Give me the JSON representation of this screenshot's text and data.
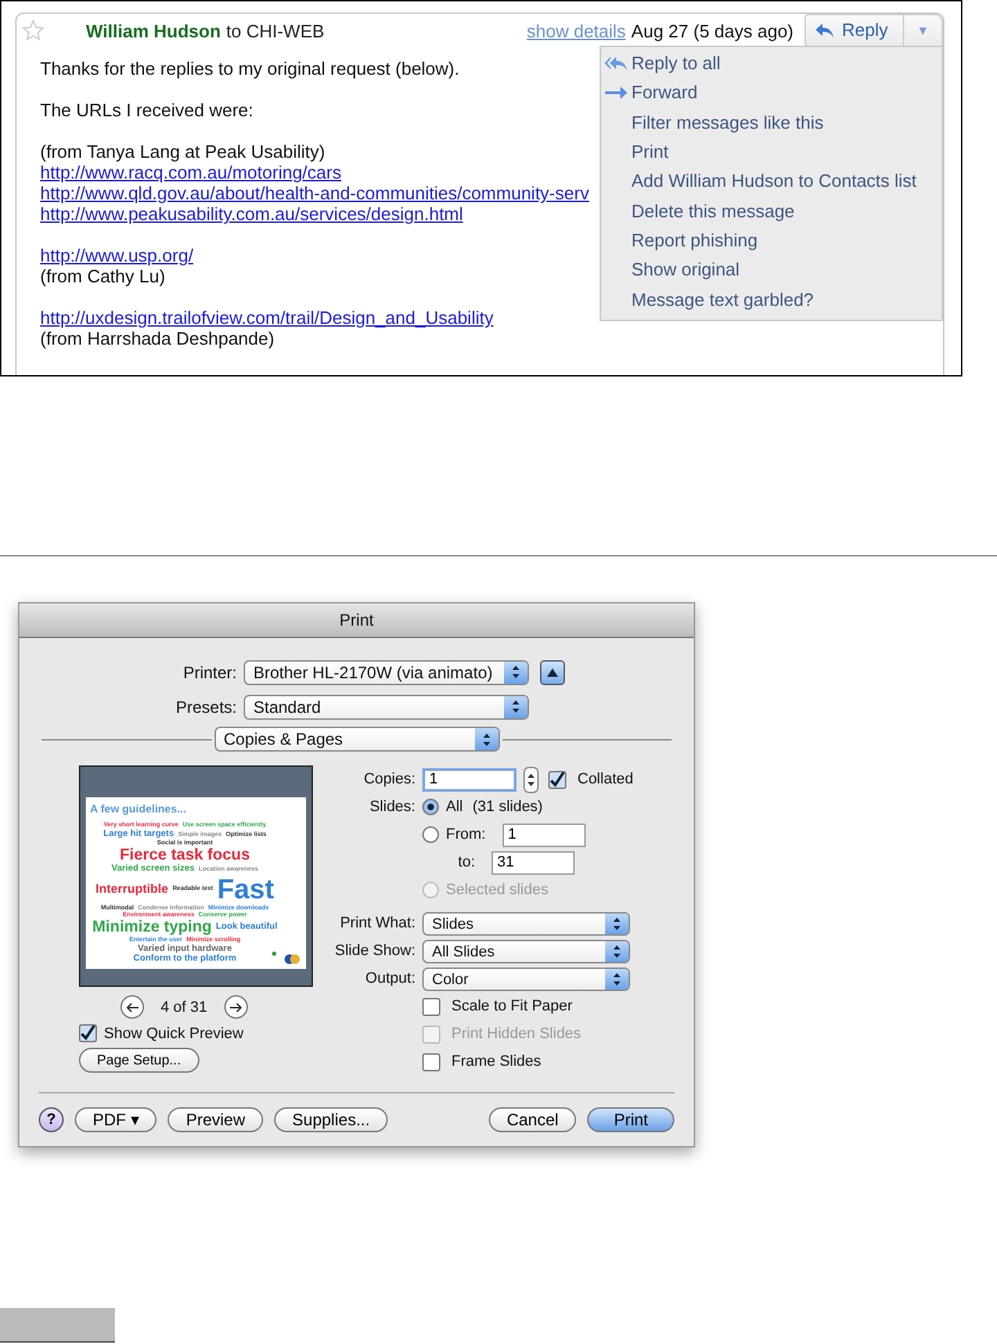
{
  "email": {
    "starred": false,
    "sender": "William Hudson",
    "recipient": "to CHI-WEB",
    "show_details": "show details",
    "date": "Aug 27 (5 days ago)",
    "reply_button": "Reply",
    "menu_button": "▼",
    "menu": [
      {
        "label": "Reply to all",
        "kind": "reply-all"
      },
      {
        "label": "Forward",
        "kind": "forward"
      },
      {
        "label": "Filter messages like this",
        "kind": "plain"
      },
      {
        "label": "Print",
        "kind": "plain"
      },
      {
        "label": "Add William Hudson to Contacts list",
        "kind": "plain"
      },
      {
        "label": "Delete this message",
        "kind": "plain"
      },
      {
        "label": "Report phishing",
        "kind": "plain"
      },
      {
        "label": "Show original",
        "kind": "plain"
      },
      {
        "label": "Message text garbled?",
        "kind": "plain"
      }
    ],
    "body": [
      [
        {
          "kind": "text",
          "text": "Thanks for the replies to my original request (below)."
        }
      ],
      [
        {
          "kind": "text",
          "text": "The URLs I received were:"
        }
      ],
      [
        {
          "kind": "text",
          "text": "(from Tanya Lang at Peak Usability)"
        },
        {
          "kind": "link",
          "text": "http://www.racq.com.au/motoring/cars"
        },
        {
          "kind": "link",
          "text": "http://www.qld.gov.au/about/health-and-communities/community-serv"
        },
        {
          "kind": "link",
          "text": "http://www.peakusability.com.au/services/design.html"
        }
      ],
      [
        {
          "kind": "link",
          "text": "http://www.usp.org/"
        },
        {
          "kind": "text",
          "text": "(from Cathy Lu)"
        }
      ],
      [
        {
          "kind": "link",
          "text": "http://uxdesign.trailofview.com/trail/Design_and_Usability"
        },
        {
          "kind": "text",
          "text": "(from Harrshada Deshpande)"
        }
      ]
    ]
  },
  "print_dialog": {
    "title": "Print",
    "printer_label": "Printer:",
    "printer": "Brother HL-2170W (via animato)",
    "presets_label": "Presets:",
    "presets": "Standard",
    "section": "Copies & Pages",
    "slide": {
      "heading": "A few guidelines...",
      "words": [
        {
          "text": "Very short learning curve",
          "color": "#e8283c",
          "kind": "tiny"
        },
        {
          "text": "Use screen space efficiently",
          "color": "#2ea84a",
          "kind": "tiny"
        },
        {
          "text": "Large hit targets",
          "color": "#2f7fd6",
          "kind": "small"
        },
        {
          "text": "Simple images",
          "color": "#888888",
          "kind": "tiny"
        },
        {
          "text": "Optimize lists",
          "color": "#333333",
          "kind": "tiny"
        },
        {
          "text": "Social is important",
          "color": "#333333",
          "kind": "tiny"
        },
        {
          "text": "Fierce task focus",
          "color": "#e8283c",
          "kind": "large"
        },
        {
          "text": "Varied screen sizes",
          "color": "#2ea84a",
          "kind": "small"
        },
        {
          "text": "Location awareness",
          "color": "#888888",
          "kind": "tiny"
        },
        {
          "text": "Interruptible",
          "color": "#e8283c",
          "kind": "medium"
        },
        {
          "text": "Readable text",
          "color": "#333333",
          "kind": "tiny"
        },
        {
          "text": "Fast",
          "color": "#2f7fd6",
          "kind": "huge"
        },
        {
          "text": "Multimodal",
          "color": "#333333",
          "kind": "tiny"
        },
        {
          "text": "Condense information",
          "color": "#888888",
          "kind": "tiny"
        },
        {
          "text": "Minimize downloads",
          "color": "#2f7fd6",
          "kind": "tiny"
        },
        {
          "text": "Environment awareness",
          "color": "#e8283c",
          "kind": "tiny"
        },
        {
          "text": "Conserve power",
          "color": "#2ea84a",
          "kind": "tiny"
        },
        {
          "text": "Minimize typing",
          "color": "#2ea84a",
          "kind": "large"
        },
        {
          "text": "Look beautiful",
          "color": "#2f7fd6",
          "kind": "small"
        },
        {
          "text": "Entertain the user",
          "color": "#2f7fd6",
          "kind": "tiny"
        },
        {
          "text": "Minimize scrolling",
          "color": "#e8283c",
          "kind": "tiny"
        },
        {
          "text": "Varied input hardware",
          "color": "#666666",
          "kind": "small"
        },
        {
          "text": "Conform to the platform",
          "color": "#2f7fd6",
          "kind": "small"
        }
      ]
    },
    "page_counter": "4 of 31",
    "show_quick_preview": {
      "label": "Show Quick Preview",
      "checked": true
    },
    "page_setup": "Page Setup...",
    "copies_label": "Copies:",
    "copies": "1",
    "collated": {
      "label": "Collated",
      "checked": true
    },
    "slides_label": "Slides:",
    "slide_options": [
      {
        "kind": "all",
        "label": "All",
        "note": "(31 slides)",
        "selected": true,
        "disabled": false
      },
      {
        "kind": "range",
        "label": "From:",
        "from": "1",
        "to_label": "to:",
        "to": "31",
        "selected": false,
        "disabled": false
      },
      {
        "kind": "plain",
        "label": "Selected slides",
        "selected": false,
        "disabled": true
      }
    ],
    "popups": [
      {
        "label": "Print What:",
        "value": "Slides"
      },
      {
        "label": "Slide Show:",
        "value": "All Slides"
      },
      {
        "label": "Output:",
        "value": "Color"
      }
    ],
    "options": [
      {
        "label": "Scale to Fit Paper",
        "checked": false,
        "disabled": false
      },
      {
        "label": "Print Hidden Slides",
        "checked": false,
        "disabled": true
      },
      {
        "label": "Frame Slides",
        "checked": false,
        "disabled": false
      }
    ],
    "help": "?",
    "buttons": [
      {
        "label": "PDF ▾",
        "kind": "left"
      },
      {
        "label": "Preview",
        "kind": "left"
      },
      {
        "label": "Supplies...",
        "kind": "left"
      },
      {
        "label": "Cancel",
        "kind": "right"
      },
      {
        "label": "Print",
        "kind": "default"
      }
    ]
  }
}
